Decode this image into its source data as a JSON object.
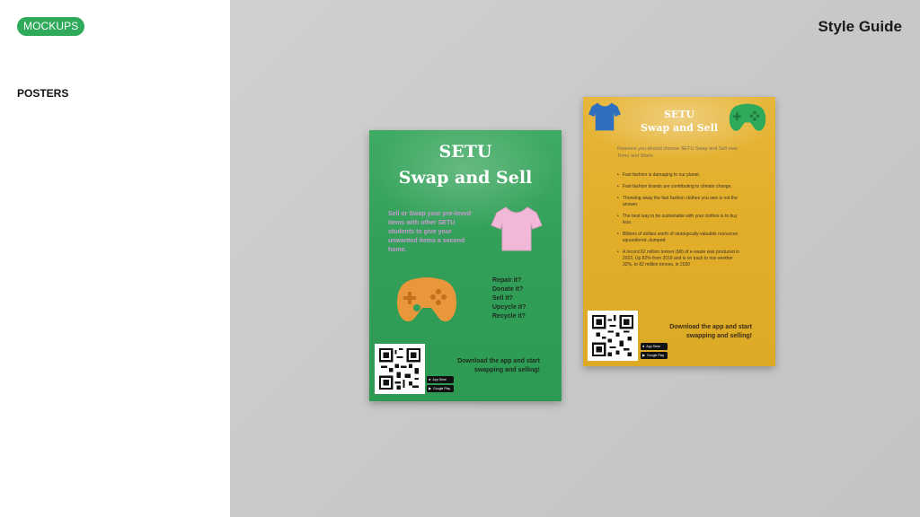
{
  "sidebar": {
    "category_pill": "MOCKUPS",
    "section_label": "POSTERS"
  },
  "header": {
    "title": "Style Guide"
  },
  "green_poster": {
    "title_line1": "SETU",
    "title_line2": "Swap and Sell",
    "description": "Sell or Swap your pre-loved items with other SETU students to give your unwanted items a second home.",
    "questions": [
      "Repair it?",
      "Donate it?",
      "Sell it?",
      "Upcycle it?",
      "Recycle it?"
    ],
    "download_text": "Download the app and start swapping and selling!",
    "badges": [
      "App Store",
      "Google Play"
    ],
    "icons": [
      "tshirt-icon",
      "gamepad-icon",
      "qr-code-icon"
    ],
    "colors": {
      "background": "#33a05a",
      "shirt": "#f2b8d8",
      "gamepad": "#e8973a"
    }
  },
  "yellow_poster": {
    "title_line1": "SETU",
    "title_line2": "Swap and Sell",
    "intro": "Reasons you should choose SETU Swap and Sell over Temu and Shein",
    "reasons": [
      "Fast fashion is damaging to our planet.",
      "Fast fashion brands are contributing to climate change.",
      "Throwing away the fast fashion clothes you own is not the answer.",
      "The best way to be sustainable with your clothes is to buy less.",
      "Billions of dollars worth of strategically-valuable resources squandered..dumped:",
      "A record 62 million tonnes (Mt) of e-waste was produced in 2022, Up 82% from 2010 and is on track to rise another 32%, to 82 million tonnes, in 2030"
    ],
    "download_text": "Download the app and start swapping and selling!",
    "badges": [
      "App Store",
      "Google Play"
    ],
    "icons": [
      "tshirt-icon",
      "gamepad-icon",
      "qr-code-icon"
    ],
    "colors": {
      "background": "#e3af2b",
      "shirt": "#2f6fc0",
      "gamepad": "#2fa95a"
    }
  },
  "colors": {
    "accent": "#2fa95a",
    "stage": "#c8c8c8"
  }
}
